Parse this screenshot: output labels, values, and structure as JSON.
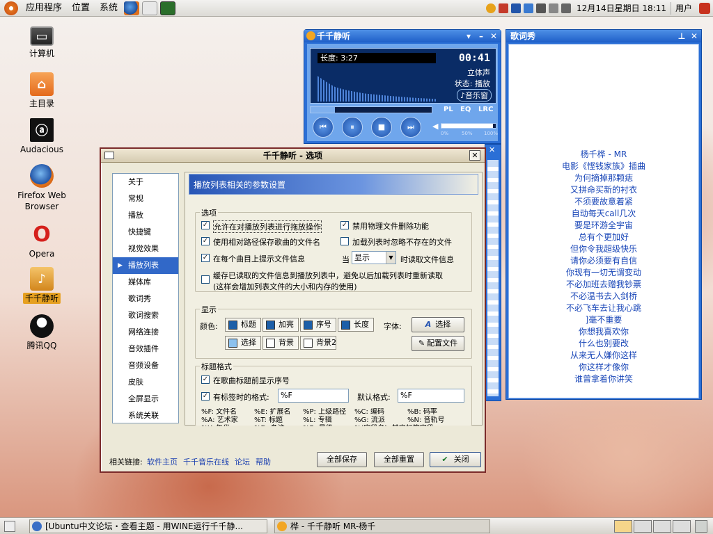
{
  "top_panel": {
    "menus": [
      "应用程序",
      "位置",
      "系统"
    ],
    "clock": "12月14日星期日 18:11",
    "user": "用户"
  },
  "desktop_icons": [
    {
      "label": "计算机",
      "icon": "computer-icon"
    },
    {
      "label": "主目录",
      "icon": "home-folder-icon"
    },
    {
      "label": "Audacious",
      "icon": "audacious-icon"
    },
    {
      "label": "Firefox Web Browser",
      "icon": "firefox-icon"
    },
    {
      "label": "Opera",
      "icon": "opera-icon"
    },
    {
      "label": "千千静听",
      "icon": "ttplayer-icon"
    },
    {
      "label": "腾讯QQ",
      "icon": "qq-icon"
    }
  ],
  "player": {
    "title": "千千静听",
    "length_label": "长度: 3:27",
    "time": "00:41",
    "channel": "立体声",
    "status": "状态: 播放",
    "music_window": "♪音乐窗",
    "tabs": [
      "PL",
      "EQ",
      "LRC"
    ],
    "volume_marks": [
      "0%",
      "50%",
      "100%"
    ],
    "progress": 0.2,
    "volume": 0.95
  },
  "lyrics": {
    "title": "歌词秀",
    "lines": [
      "杨千桦 - MR",
      "电影《悭钱家族》插曲",
      "为何摘掉那颗痣",
      "又拼命买新的衬衣",
      "不须要故意着紧",
      "自动每天call几次",
      "要是环游全宇宙",
      "总有个更加好",
      "但你令我超级快乐",
      "请你必须要有自信",
      "你现有一切无谓变动",
      "不必加班去赠我钞票",
      "不必温书去入剑桥",
      "不必飞车去让我心跳",
      "]毫不重要",
      "你想我喜欢你",
      "什么也别要改",
      "从来无人嫌你这样",
      "你这样才像你",
      "谁曾拿着你讲笑"
    ]
  },
  "dialog": {
    "title": "千千静听 - 选项",
    "nav": [
      "关于",
      "常规",
      "播放",
      "快捷键",
      "视觉效果",
      "播放列表",
      "媒体库",
      "歌词秀",
      "歌词搜索",
      "网络连接",
      "音效插件",
      "音频设备",
      "皮肤",
      "全屏显示",
      "系统关联"
    ],
    "selected_nav": "播放列表",
    "header": "播放列表相关的参数设置",
    "options_group": "选项",
    "opts": {
      "drag": "允许在对播放列表进行拖放操作",
      "phys_delete": "禁用物理文件删除功能",
      "relpath": "使用相对路径保存歌曲的文件名",
      "ignore_missing": "加载列表时忽略不存在的文件",
      "tip_info": "在每个曲目上提示文件信息",
      "when": "当",
      "when_select": "显示",
      "when_suffix": "时读取文件信息",
      "cache_line1": "缓存已读取的文件信息到播放列表中，避免以后加载列表时重新读取",
      "cache_line2": "(这样会增加列表文件的大小和内存的使用)"
    },
    "display_group": "显示",
    "colors_label": "颜色:",
    "color_buttons": [
      {
        "label": "标题",
        "color": "#1d5fa8"
      },
      {
        "label": "加亮",
        "color": "#1d5fa8"
      },
      {
        "label": "序号",
        "color": "#1d5fa8"
      },
      {
        "label": "长度",
        "color": "#1d5fa8"
      },
      {
        "label": "选择",
        "color": "#8cc1ee"
      },
      {
        "label": "背景",
        "color": "#ffffff"
      },
      {
        "label": "背景2",
        "color": "#ffffff"
      }
    ],
    "font_label": "字体:",
    "font_select": "选择",
    "config_file": "配置文件",
    "title_format_group": "标题格式",
    "show_index": "在歌曲标题前显示序号",
    "tagged_format": "有标签时的格式:",
    "tagged_value": "%F",
    "default_format": "默认格式:",
    "default_value": "%F",
    "format_rows": [
      [
        "%F: 文件名",
        "%E: 扩展名",
        "%P: 上级路径",
        "%C: 编码",
        "%B: 码率"
      ],
      [
        "%A: 艺术家",
        "%T: 标题",
        "%L: 专辑",
        "%G: 流派",
        "%N: 音轨号"
      ],
      [
        "%Y: 年代",
        "%D: 备注",
        "%R: 星级",
        "%(字段名): 其它标签字段",
        ""
      ]
    ],
    "links_label": "相关链接:",
    "links": [
      "软件主页",
      "千千音乐在线",
      "论坛",
      "帮助"
    ],
    "buttons": {
      "save_all": "全部保存",
      "reset_all": "全部重置",
      "close": "关闭"
    }
  },
  "taskbar": {
    "tasks": [
      "[Ubuntu中文论坛・查看主题 - 用WINE运行千千静...",
      "桦 - 千千静听    MR-杨千"
    ]
  }
}
